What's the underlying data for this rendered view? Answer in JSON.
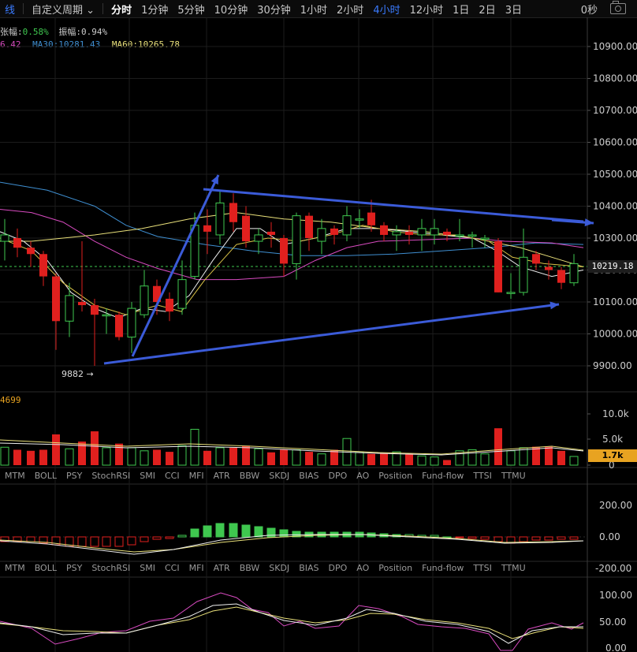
{
  "toolbar": {
    "first_label": "线",
    "custom_period": "自定义周期",
    "periods": [
      "分时",
      "1分钟",
      "5分钟",
      "10分钟",
      "30分钟",
      "1小时",
      "2小时",
      "4小时",
      "12小时",
      "1日",
      "2日",
      "3日"
    ],
    "active_period": "4小时",
    "countdown": "0秒"
  },
  "info": {
    "change_label": "张幅:",
    "change_value": "0.58%",
    "amplitude_label": "振幅:",
    "amplitude_value": "0.94%",
    "ma_short": "6.42",
    "ma30": "MA30:10281.43",
    "ma60": "MA60:10265.78",
    "volume_value": "4699"
  },
  "price_axis": [
    "10900.00",
    "10800.00",
    "10700.00",
    "10600.00",
    "10500.00",
    "10400.00",
    "10300.00",
    "10200.00",
    "10100.00",
    "10000.00",
    "9900.00"
  ],
  "current_price": "10219.18",
  "low_label": "9882 →",
  "volume_axis": [
    "10.0k",
    "5.0k",
    "0"
  ],
  "volume_tag": "1.7k",
  "indicator_tabs": [
    "MTM",
    "BOLL",
    "PSY",
    "StochRSI",
    "SMI",
    "CCI",
    "MFI",
    "ATR",
    "BBW",
    "SKDJ",
    "BIAS",
    "DPO",
    "AO",
    "Position",
    "Fund-flow",
    "TTSI",
    "TTMU"
  ],
  "macd_axis": [
    "200.00",
    "0.00",
    "-200.00"
  ],
  "kdj_axis": [
    "100.00",
    "50.00",
    "0.00"
  ],
  "colors": {
    "up": "#3fc74f",
    "down": "#e0201e",
    "accent": "#3a7bff",
    "trendline": "#3b5bd8",
    "ma_yellow": "#e9e07a",
    "ma_pink": "#d84bc0",
    "ma_blue": "#3f8fd1",
    "ma_white": "#eeeeee"
  }
}
